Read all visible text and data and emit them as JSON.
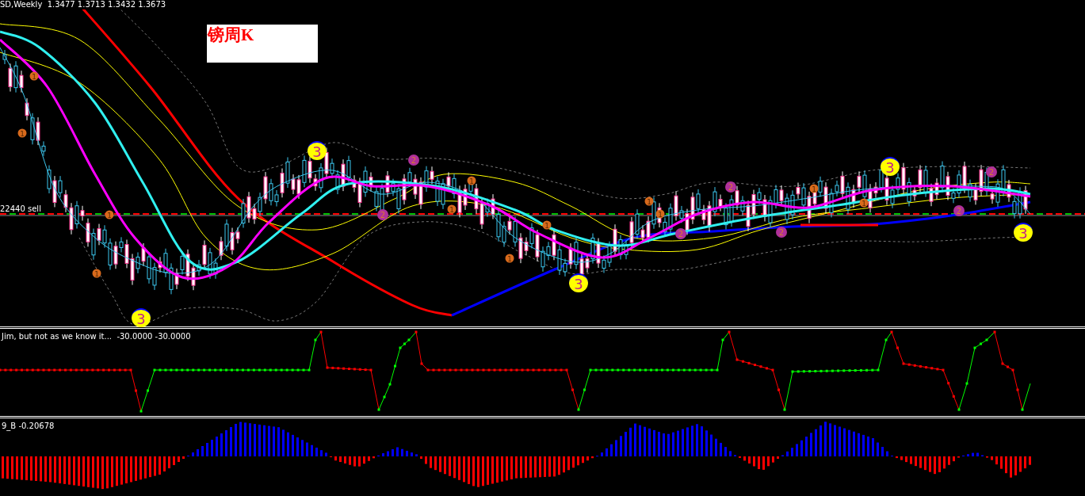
{
  "header": "SD,Weekly  1.3477 1.3713 1.3432 1.3673",
  "title_box": "镑周K",
  "level_label": "22440 sell",
  "markers": [
    {
      "label": "3",
      "kind": "big"
    },
    {
      "label": "3",
      "kind": "big"
    },
    {
      "label": "3",
      "kind": "big"
    },
    {
      "label": "3",
      "kind": "big"
    },
    {
      "label": "3",
      "kind": "big"
    },
    {
      "label": "1",
      "kind": "orange"
    },
    {
      "label": "1",
      "kind": "orange"
    },
    {
      "label": "1",
      "kind": "orange"
    },
    {
      "label": "1",
      "kind": "orange"
    },
    {
      "label": "1",
      "kind": "orange"
    },
    {
      "label": "1",
      "kind": "orange"
    },
    {
      "label": "1",
      "kind": "orange"
    },
    {
      "label": "1",
      "kind": "orange"
    },
    {
      "label": "1",
      "kind": "orange"
    },
    {
      "label": "1",
      "kind": "orange"
    },
    {
      "label": "1",
      "kind": "orange"
    },
    {
      "label": "1",
      "kind": "orange"
    },
    {
      "label": "2",
      "kind": "purple"
    },
    {
      "label": "2",
      "kind": "purple"
    },
    {
      "label": "2",
      "kind": "purple"
    },
    {
      "label": "2",
      "kind": "purple"
    },
    {
      "label": "2",
      "kind": "purple"
    },
    {
      "label": "2",
      "kind": "purple"
    },
    {
      "label": "2",
      "kind": "purple"
    }
  ],
  "oscillator_label": "Jim, but not as we know it...  -30.0000 -30.0000",
  "histogram_label": "9_B -0.20678"
}
